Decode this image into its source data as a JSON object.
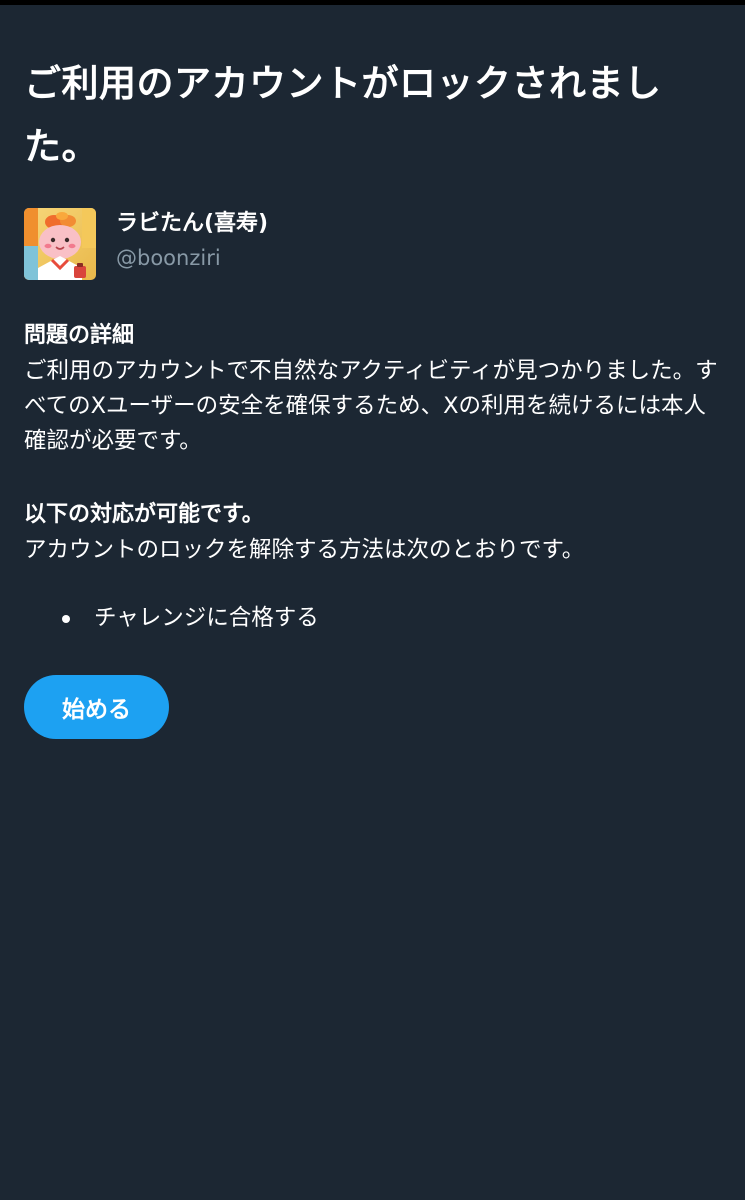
{
  "page": {
    "title": "ご利用のアカウントがロックされました。"
  },
  "account": {
    "name": "ラビたん(喜寿)",
    "handle": "@boonziri",
    "avatar_icon": "rabbit-character-avatar"
  },
  "details": {
    "heading": "問題の詳細",
    "body": "ご利用のアカウントで不自然なアクティビティが見つかりました。すべてのXユーザーの安全を確保するため、Xの利用を続けるには本人確認が必要です。"
  },
  "options": {
    "heading": "以下の対応が可能です。",
    "body": "アカウントのロックを解除する方法は次のとおりです。",
    "items": [
      {
        "label": "チャレンジに合格する"
      }
    ]
  },
  "actions": {
    "start_label": "始める"
  },
  "colors": {
    "background": "#1c2733",
    "accent": "#1da1f2",
    "secondary_text": "#8899a6"
  }
}
